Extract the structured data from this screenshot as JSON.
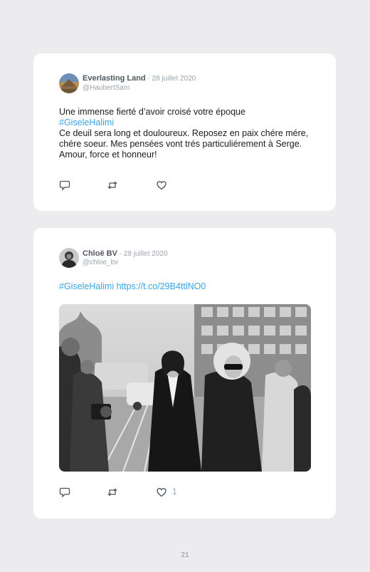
{
  "tweets": [
    {
      "display_name": "Everlasting Land",
      "date_sep": " · ",
      "date": "28 juillet 2020",
      "handle": "@HaubertSam",
      "line1": "Une immense fierté d’avoir croisé votre époque",
      "hashtag": "#GiseleHalimi",
      "line2": "Ce deuil sera long et douloureux. Reposez en paix chére mére, chére soeur. Mes pensées vont trés particuliérement à Serge. Amour, force et honneur!",
      "icons": [
        "reply-icon",
        "retweet-icon",
        "heart-icon"
      ],
      "like_count": ""
    },
    {
      "display_name": "Chloë BV",
      "date_sep": " · ",
      "date": "28 juillet 2020",
      "handle": "@chloe_bv",
      "hashtag": "#GiseleHalimi",
      "link": "https://t.co/29B4ttlNO0",
      "icons": [
        "reply-icon",
        "retweet-icon",
        "heart-icon"
      ],
      "like_count": "1",
      "image": "black-and-white-press-photo"
    }
  ],
  "page_number": "21",
  "colors": {
    "background": "#ececee",
    "card": "#ffffff",
    "link": "#3aa4e1",
    "muted": "#9aa3ad"
  }
}
